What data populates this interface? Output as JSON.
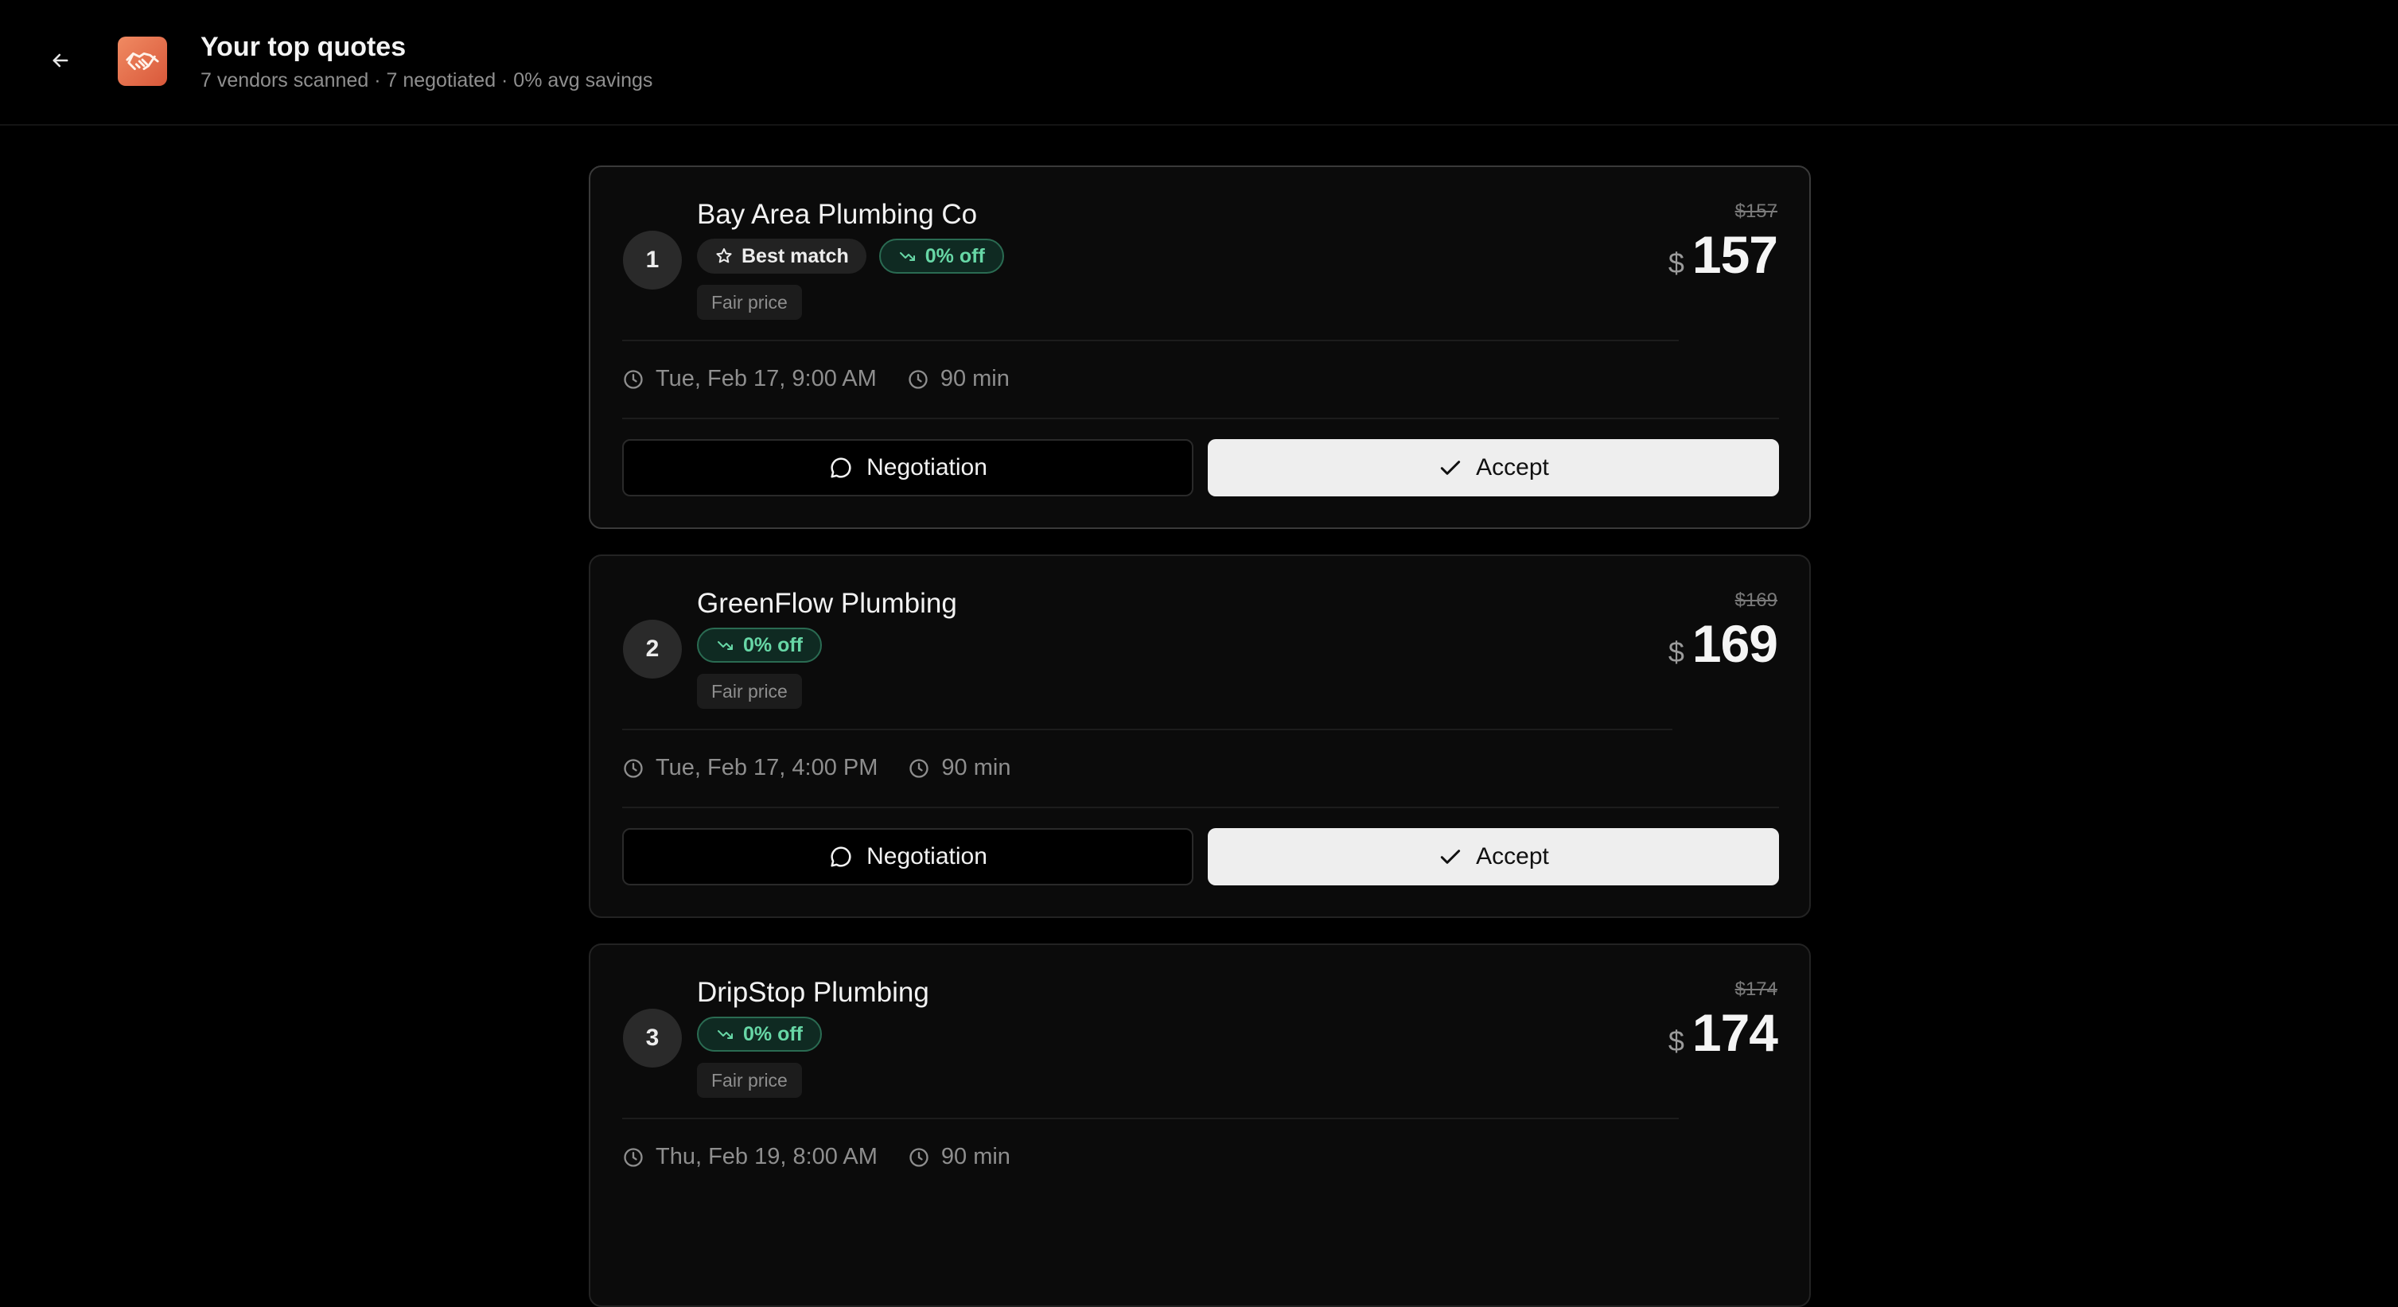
{
  "header": {
    "title": "Your top quotes",
    "subtitle": "7 vendors scanned · 7 negotiated · 0% avg savings",
    "back_icon": "arrow-left-icon",
    "app_icon": "handshake-icon",
    "app_icon_color": "#e8724c"
  },
  "labels": {
    "negotiation": "Negotiation",
    "accept": "Accept",
    "currency": "$"
  },
  "quotes": [
    {
      "rank": "1",
      "name": "Bay Area Plumbing Co",
      "best_match": "Best match",
      "discount": "0% off",
      "fair": "Fair price",
      "old_price": "$157",
      "price": "157",
      "date": "Tue, Feb 17, 9:00 AM",
      "duration": "90 min"
    },
    {
      "rank": "2",
      "name": "GreenFlow Plumbing",
      "discount": "0% off",
      "fair": "Fair price",
      "old_price": "$169",
      "price": "169",
      "date": "Tue, Feb 17, 4:00 PM",
      "duration": "90 min"
    },
    {
      "rank": "3",
      "name": "DripStop Plumbing",
      "discount": "0% off",
      "fair": "Fair price",
      "old_price": "$174",
      "price": "174",
      "date": "Thu, Feb 19, 8:00 AM",
      "duration": "90 min"
    }
  ],
  "colors": {
    "background": "#000000",
    "card": "#0b0b0b",
    "discount_green": "#67d7a6",
    "accept_bg": "#eeeeee"
  }
}
